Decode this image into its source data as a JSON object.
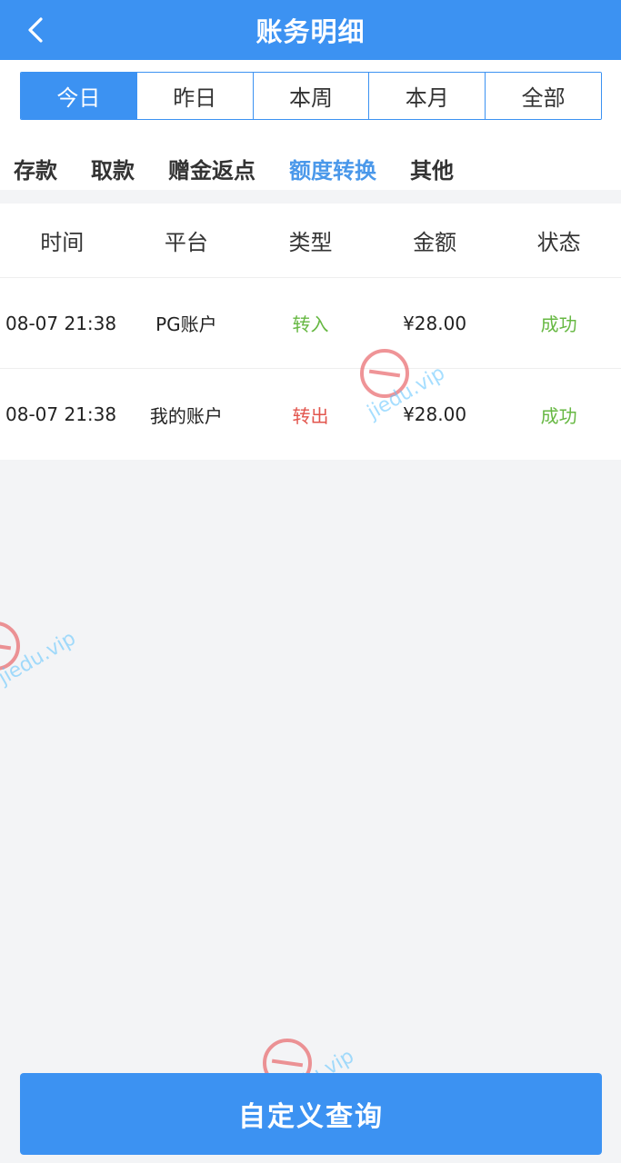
{
  "header": {
    "title": "账务明细",
    "back_icon": "chevron-left-icon"
  },
  "periods": [
    {
      "label": "今日",
      "active": true
    },
    {
      "label": "昨日",
      "active": false
    },
    {
      "label": "本周",
      "active": false
    },
    {
      "label": "本月",
      "active": false
    },
    {
      "label": "全部",
      "active": false
    }
  ],
  "categories": [
    {
      "label": "存款",
      "active": false
    },
    {
      "label": "取款",
      "active": false
    },
    {
      "label": "赠金返点",
      "active": false
    },
    {
      "label": "额度转换",
      "active": true
    },
    {
      "label": "其他",
      "active": false
    }
  ],
  "table": {
    "headers": [
      "时间",
      "平台",
      "类型",
      "金额",
      "状态"
    ],
    "rows": [
      {
        "time": "08-07 21:38",
        "platform": "PG账户",
        "type": "转入",
        "amount": "¥28.00",
        "status": "成功"
      },
      {
        "time": "08-07 21:38",
        "platform": "我的账户",
        "type": "转出",
        "amount": "¥28.00",
        "status": "成功"
      }
    ]
  },
  "footer": {
    "query_label": "自定义查询"
  },
  "colors": {
    "primary": "#3c92f2",
    "success": "#67b843",
    "danger": "#e2554d",
    "accent_text": "#4a98ea"
  },
  "watermark": {
    "text": "jiedu.vip"
  }
}
